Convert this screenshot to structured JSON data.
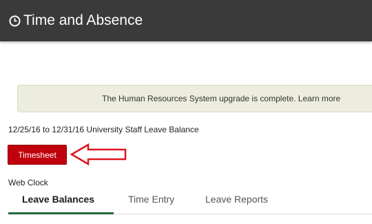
{
  "header": {
    "title": "Time and Absence",
    "icon": "clock-icon"
  },
  "banner": {
    "text": "The Human Resources System upgrade is complete. Learn more"
  },
  "period_label": "12/25/16 to 12/31/16 University Staff Leave Balance",
  "timesheet_button": {
    "label": "Timesheet",
    "color": "#c0000c"
  },
  "annotation": {
    "icon": "red-arrow-icon",
    "color": "#e0141e"
  },
  "web_clock": {
    "label": "Web Clock"
  },
  "tabs": [
    {
      "label": "Leave Balances",
      "active": true
    },
    {
      "label": "Time Entry",
      "active": false
    },
    {
      "label": "Leave Reports",
      "active": false
    }
  ],
  "colors": {
    "header_bg": "#3a3a3a",
    "banner_bg": "#ececdf",
    "tab_accent": "#23683d"
  }
}
